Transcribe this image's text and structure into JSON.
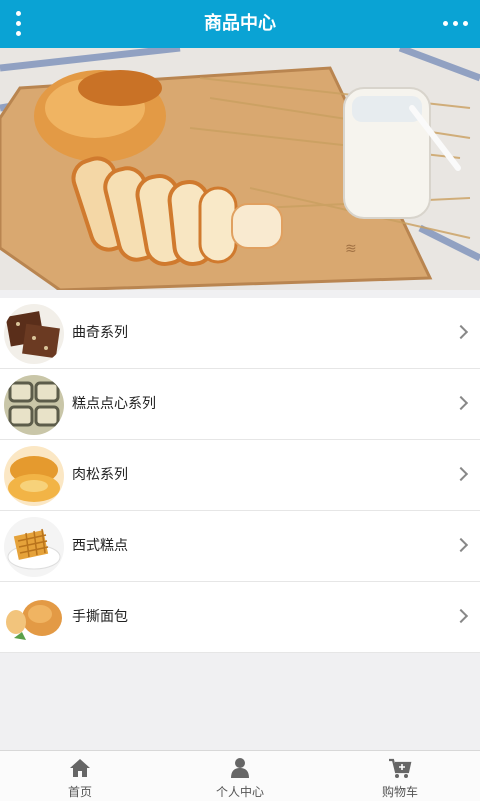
{
  "header": {
    "title": "商品中心",
    "menu_icon": "kebab-menu-icon",
    "more_icon": "more-dots-icon"
  },
  "banner": {
    "slide_count": 1,
    "active_slide": 1
  },
  "categories": [
    {
      "label": "曲奇系列",
      "icon": "chevron-right-icon"
    },
    {
      "label": "糕点点心系列",
      "icon": "chevron-right-icon"
    },
    {
      "label": "肉松系列",
      "icon": "chevron-right-icon"
    },
    {
      "label": "西式糕点",
      "icon": "chevron-right-icon"
    },
    {
      "label": "手撕面包",
      "icon": "chevron-right-icon"
    }
  ],
  "bottom_nav": [
    {
      "label": "首页",
      "icon": "home-icon"
    },
    {
      "label": "个人中心",
      "icon": "user-icon"
    },
    {
      "label": "购物车",
      "icon": "cart-icon"
    }
  ],
  "colors": {
    "header_bg": "#0aa3d4",
    "page_bg": "#f0f0f2",
    "icon_gray": "#666666"
  }
}
